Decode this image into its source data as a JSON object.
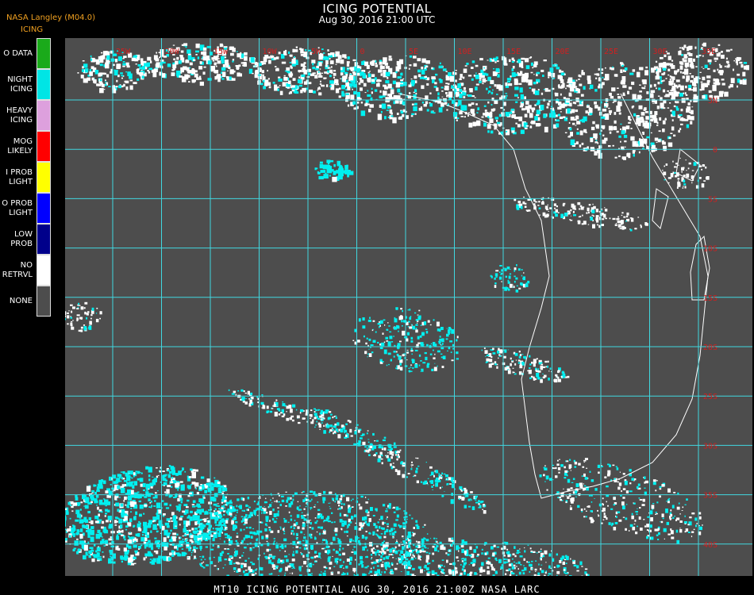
{
  "header": {
    "title": "ICING POTENTIAL",
    "subtitle": "Aug 30, 2016 21:00 UTC",
    "producer": "NASA Langley (M04.0)",
    "legend_title": "ICING"
  },
  "legend": [
    {
      "lines": [
        "O DATA"
      ],
      "color": "#1aaa1a"
    },
    {
      "lines": [
        "NIGHT",
        "ICING"
      ],
      "color": "#00e5e5"
    },
    {
      "lines": [
        "HEAVY",
        "ICING"
      ],
      "color": "#dda0dd"
    },
    {
      "lines": [
        "MOG",
        "LIKELY"
      ],
      "color": "#ff0000"
    },
    {
      "lines": [
        "I PROB",
        "LIGHT"
      ],
      "color": "#ffff00"
    },
    {
      "lines": [
        "O PROB",
        "LIGHT"
      ],
      "color": "#0000ff"
    },
    {
      "lines": [
        "LOW",
        "PROB"
      ],
      "color": "#00008b"
    },
    {
      "lines": [
        "NO",
        "RETRVL"
      ],
      "color": "#ffffff"
    },
    {
      "lines": [
        "NONE"
      ],
      "color": "#4d4d4d"
    }
  ],
  "map": {
    "background": "#4d4d4d",
    "grid_color": "#40d8e0",
    "coast_color": "#ffffff",
    "label_color": "#d02020",
    "lon_labels": [
      "25W",
      "20W",
      "15W",
      "10W",
      "5W",
      "0",
      "5E",
      "10E",
      "15E",
      "20E",
      "25E",
      "30E",
      "35E"
    ],
    "lat_labels": [
      "5N",
      "0",
      "5S",
      "10S",
      "15S",
      "20S",
      "25S",
      "30S",
      "35S",
      "40S"
    ]
  },
  "footer": "MT10  ICING POTENTIAL   AUG 30, 2016 21:00Z   NASA LARC"
}
